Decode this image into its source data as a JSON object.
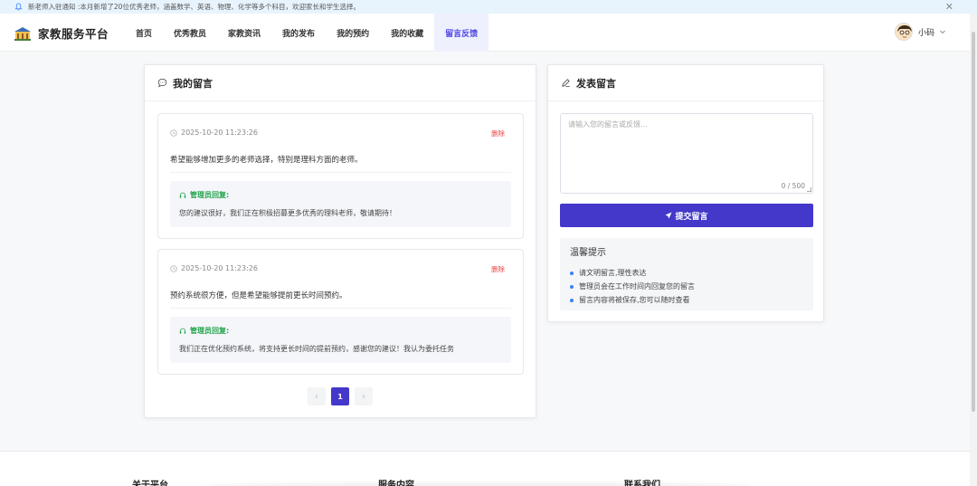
{
  "notice": {
    "text": "新老师入驻通知 :本月新增了20位优秀老师，涵盖数学、英语、物理、化学等多个科目，欢迎家长和学生选择。"
  },
  "nav": {
    "brand": "家教服务平台",
    "items": [
      {
        "label": "首页"
      },
      {
        "label": "优秀教员"
      },
      {
        "label": "家教资讯"
      },
      {
        "label": "我的发布"
      },
      {
        "label": "我的预约"
      },
      {
        "label": "我的收藏"
      },
      {
        "label": "留言反馈",
        "active": true
      }
    ],
    "user_name": "小码"
  },
  "messages_panel": {
    "title": "我的留言",
    "messages": [
      {
        "time": "2025-10-20 11:23:26",
        "delete_label": "删除",
        "content": "希望能够增加更多的老师选择，特别是理科方面的老师。",
        "reply_label": "管理员回复:",
        "reply": "您的建议很好，我们正在积极招募更多优秀的理科老师，敬请期待！"
      },
      {
        "time": "2025-10-20 11:23:26",
        "delete_label": "删除",
        "content": "预约系统很方便，但是希望能够提前更长时间预约。",
        "reply_label": "管理员回复:",
        "reply": "我们正在优化预约系统，将支持更长时间的提前预约，感谢您的建议！我认为委托任务"
      }
    ],
    "pagination": {
      "prev": "‹",
      "current": "1",
      "next": "›"
    }
  },
  "post_panel": {
    "title": "发表留言",
    "placeholder": "请输入您的留言或反馈...",
    "counter": "0 / 500",
    "submit_label": "提交留言",
    "tips_title": "温馨提示",
    "tips": [
      "请文明留言,理性表达",
      "管理员会在工作时间内回复您的留言",
      "留言内容将被保存,您可以随时查看"
    ]
  },
  "footer": {
    "col1": "关于平台",
    "col2": "服务内容",
    "col3": "联系我们"
  },
  "colors": {
    "primary": "#4338ca",
    "danger": "#ef4444",
    "reply_green": "#22a34a"
  }
}
